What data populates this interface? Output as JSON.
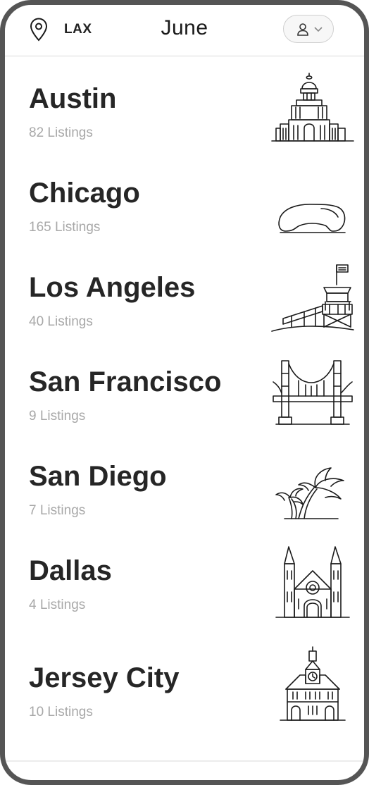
{
  "header": {
    "location_code": "LAX",
    "brand": "June",
    "icons": {
      "location": "map-pin-icon",
      "user": "user-icon",
      "chevron": "chevron-down-icon"
    }
  },
  "cities": [
    {
      "name": "Austin",
      "listings": "82 Listings",
      "icon": "capitol-building-icon"
    },
    {
      "name": "Chicago",
      "listings": "165 Listings",
      "icon": "cloud-gate-bean-icon"
    },
    {
      "name": "Los Angeles",
      "listings": "40 Listings",
      "icon": "lifeguard-tower-icon"
    },
    {
      "name": "San Francisco",
      "listings": "9 Listings",
      "icon": "golden-gate-bridge-icon"
    },
    {
      "name": "San Diego",
      "listings": "7 Listings",
      "icon": "palm-trees-icon"
    },
    {
      "name": "Dallas",
      "listings": "4 Listings",
      "icon": "cathedral-icon"
    },
    {
      "name": "Jersey City",
      "listings": "10 Listings",
      "icon": "clock-tower-hall-icon"
    }
  ]
}
